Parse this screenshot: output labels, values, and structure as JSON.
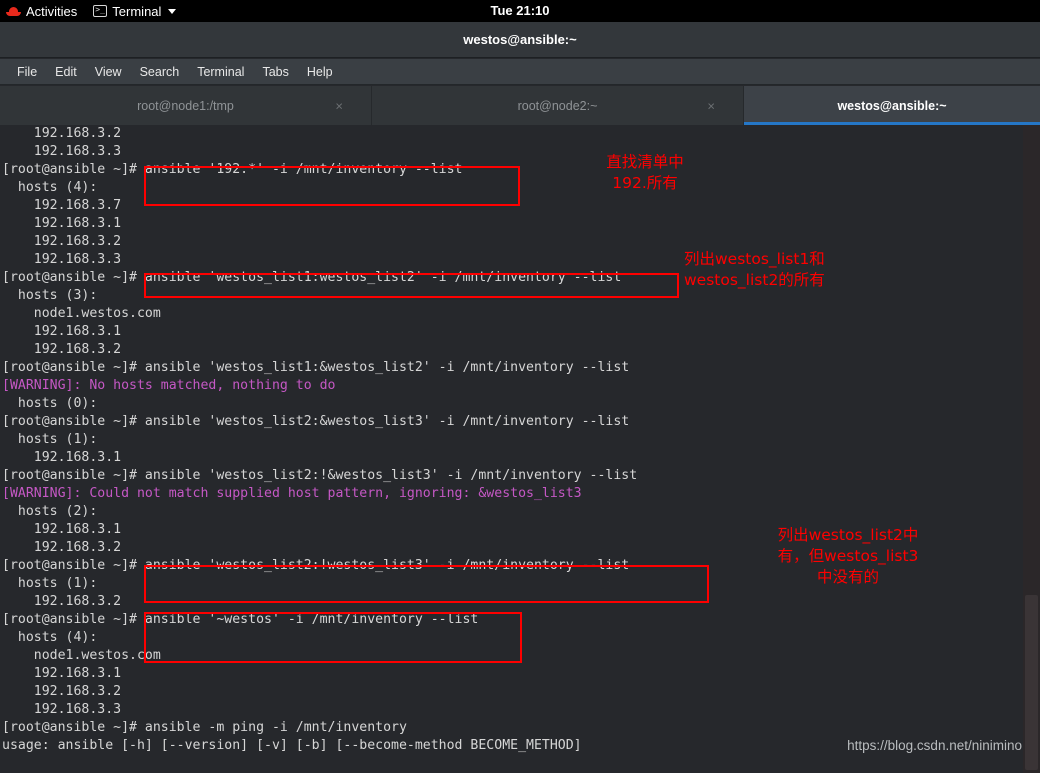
{
  "gnome": {
    "activities": "Activities",
    "app_name": "Terminal",
    "clock": "Tue 21:10",
    "redhat_icon": "redhat-logo-icon",
    "terminal_icon": "terminal-icon",
    "dropdown_icon": "chevron-down-icon"
  },
  "window": {
    "title": "westos@ansible:~"
  },
  "menubar": {
    "items": [
      {
        "label": "File"
      },
      {
        "label": "Edit"
      },
      {
        "label": "View"
      },
      {
        "label": "Search"
      },
      {
        "label": "Terminal"
      },
      {
        "label": "Tabs"
      },
      {
        "label": "Help"
      }
    ]
  },
  "tabs": [
    {
      "label": "root@node1:/tmp",
      "active": false,
      "close": "×"
    },
    {
      "label": "root@node2:~",
      "active": false,
      "close": "×"
    },
    {
      "label": "westos@ansible:~",
      "active": true,
      "close": ""
    }
  ],
  "terminal": {
    "prompt": "[root@ansible ~]# ",
    "lines": [
      {
        "text": "    192.168.3.2",
        "warn": false
      },
      {
        "text": "    192.168.3.3",
        "warn": false
      },
      {
        "text": "[root@ansible ~]# ansible '192.*' -i /mnt/inventory --list",
        "warn": false
      },
      {
        "text": "  hosts (4):",
        "warn": false
      },
      {
        "text": "    192.168.3.7",
        "warn": false
      },
      {
        "text": "    192.168.3.1",
        "warn": false
      },
      {
        "text": "    192.168.3.2",
        "warn": false
      },
      {
        "text": "    192.168.3.3",
        "warn": false
      },
      {
        "text": "[root@ansible ~]# ansible 'westos_list1:westos_list2' -i /mnt/inventory --list",
        "warn": false
      },
      {
        "text": "  hosts (3):",
        "warn": false
      },
      {
        "text": "    node1.westos.com",
        "warn": false
      },
      {
        "text": "    192.168.3.1",
        "warn": false
      },
      {
        "text": "    192.168.3.2",
        "warn": false
      },
      {
        "text": "[root@ansible ~]# ansible 'westos_list1:&westos_list2' -i /mnt/inventory --list",
        "warn": false
      },
      {
        "text": "[WARNING]: No hosts matched, nothing to do",
        "warn": true
      },
      {
        "text": "  hosts (0):",
        "warn": false
      },
      {
        "text": "[root@ansible ~]# ansible 'westos_list2:&westos_list3' -i /mnt/inventory --list",
        "warn": false
      },
      {
        "text": "  hosts (1):",
        "warn": false
      },
      {
        "text": "    192.168.3.1",
        "warn": false
      },
      {
        "text": "[root@ansible ~]# ansible 'westos_list2:!&westos_list3' -i /mnt/inventory --list",
        "warn": false
      },
      {
        "text": "[WARNING]: Could not match supplied host pattern, ignoring: &westos_list3",
        "warn": true
      },
      {
        "text": "  hosts (2):",
        "warn": false
      },
      {
        "text": "    192.168.3.1",
        "warn": false
      },
      {
        "text": "    192.168.3.2",
        "warn": false
      },
      {
        "text": "[root@ansible ~]# ansible 'westos_list2:!westos_list3' -i /mnt/inventory --list",
        "warn": false
      },
      {
        "text": "  hosts (1):",
        "warn": false
      },
      {
        "text": "    192.168.3.2",
        "warn": false
      },
      {
        "text": "[root@ansible ~]# ansible '~westos' -i /mnt/inventory --list",
        "warn": false
      },
      {
        "text": "  hosts (4):",
        "warn": false
      },
      {
        "text": "    node1.westos.com",
        "warn": false
      },
      {
        "text": "    192.168.3.1",
        "warn": false
      },
      {
        "text": "    192.168.3.2",
        "warn": false
      },
      {
        "text": "    192.168.3.3",
        "warn": false
      },
      {
        "text": "[root@ansible ~]# ansible -m ping -i /mnt/inventory",
        "warn": false
      },
      {
        "text": "usage: ansible [-h] [--version] [-v] [-b] [--become-method BECOME_METHOD]",
        "warn": false
      }
    ]
  },
  "annotations": {
    "color": "#fe0000",
    "notes": [
      {
        "id": "note-find-192",
        "text": "直找清单中\n192.所有"
      },
      {
        "id": "note-list1-list2",
        "text": "列出westos_list1和\nwestos_list2的所有"
      },
      {
        "id": "note-list2-not-list3",
        "text": "列出westos_list2中\n有，但westos_list3\n中没有的"
      }
    ],
    "boxes": [
      {
        "id": "box-cmd-192"
      },
      {
        "id": "box-cmd-list1-list2"
      },
      {
        "id": "box-cmd-list2-not-list3"
      },
      {
        "id": "box-cmd-tilde-westos"
      }
    ]
  },
  "watermark": "https://blog.csdn.net/ninimino"
}
